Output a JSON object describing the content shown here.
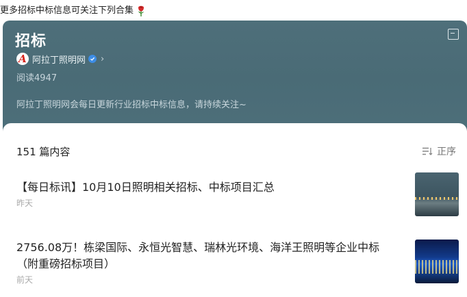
{
  "intro": {
    "text": "更多招标中标信息可关注下列合集"
  },
  "header": {
    "title": "招标",
    "author": {
      "avatar_letter": "A",
      "name": "阿拉丁照明网"
    },
    "reads": "阅读4947",
    "description": "阿拉丁照明网会每日更新行业招标中标信息，请持续关注~"
  },
  "list": {
    "count": "151 篇内容",
    "sort_label": "正序",
    "articles": [
      {
        "title": "【每日标讯】10月10日照明相关招标、中标项目汇总",
        "time": "昨天"
      },
      {
        "title": "2756.08万！栋梁国际、永恒光智慧、瑞林光环境、海洋王照明等企业中标（附重磅招标项目）",
        "time": "前天"
      }
    ]
  },
  "icons": {
    "rose": "rose-icon",
    "exit": "exit-icon",
    "verified": "verified-icon",
    "chevron": "chevron-right-icon",
    "sort": "sort-icon"
  },
  "colors": {
    "header_bg": "#4e6f7a",
    "verified": "#3d8de6",
    "logo_red": "#d8261f"
  }
}
